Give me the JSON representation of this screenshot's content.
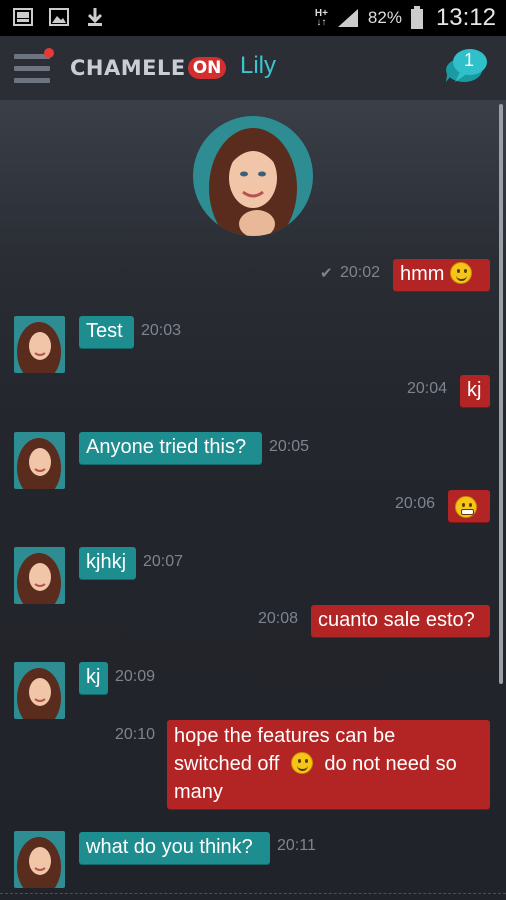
{
  "status_bar": {
    "left_icons": [
      "gallery-icon",
      "image-icon",
      "download-icon"
    ],
    "network_type_top": "H+",
    "network_type_bottom": "↓↑",
    "battery_percent": "82%",
    "time": "13:12"
  },
  "app_bar": {
    "logo_text": "CHAMELE",
    "logo_on": "ON",
    "contact_name": "Lily",
    "chats_badge_count": "1",
    "colors": {
      "accent": "#3ec3cf",
      "brand_red": "#d32f2f"
    }
  },
  "chat": {
    "incoming_color": "#1e8d8f",
    "outgoing_color": "#b32424",
    "messages": [
      {
        "direction": "out",
        "text": "hmm",
        "emoji": "smile",
        "time": "20:02",
        "read": true
      },
      {
        "direction": "in",
        "text": "Test",
        "time": "20:03"
      },
      {
        "direction": "out",
        "text": "kj",
        "time": "20:04"
      },
      {
        "direction": "in",
        "text": "Anyone tried this?",
        "time": "20:05"
      },
      {
        "direction": "out",
        "text": "",
        "emoji": "grin",
        "time": "20:06"
      },
      {
        "direction": "in",
        "text": "kjhkj",
        "time": "20:07"
      },
      {
        "direction": "out",
        "text": "cuanto sale esto?",
        "time": "20:08"
      },
      {
        "direction": "in",
        "text": "kj",
        "time": "20:09"
      },
      {
        "direction": "out",
        "text_line1": "hope the features can be",
        "text_line2a": "switched off",
        "emoji": "smile",
        "text_line2b": "do not need so",
        "text_line3": "many",
        "time": "20:10"
      },
      {
        "direction": "in",
        "text": "what do you think?",
        "time": "20:11"
      }
    ]
  }
}
